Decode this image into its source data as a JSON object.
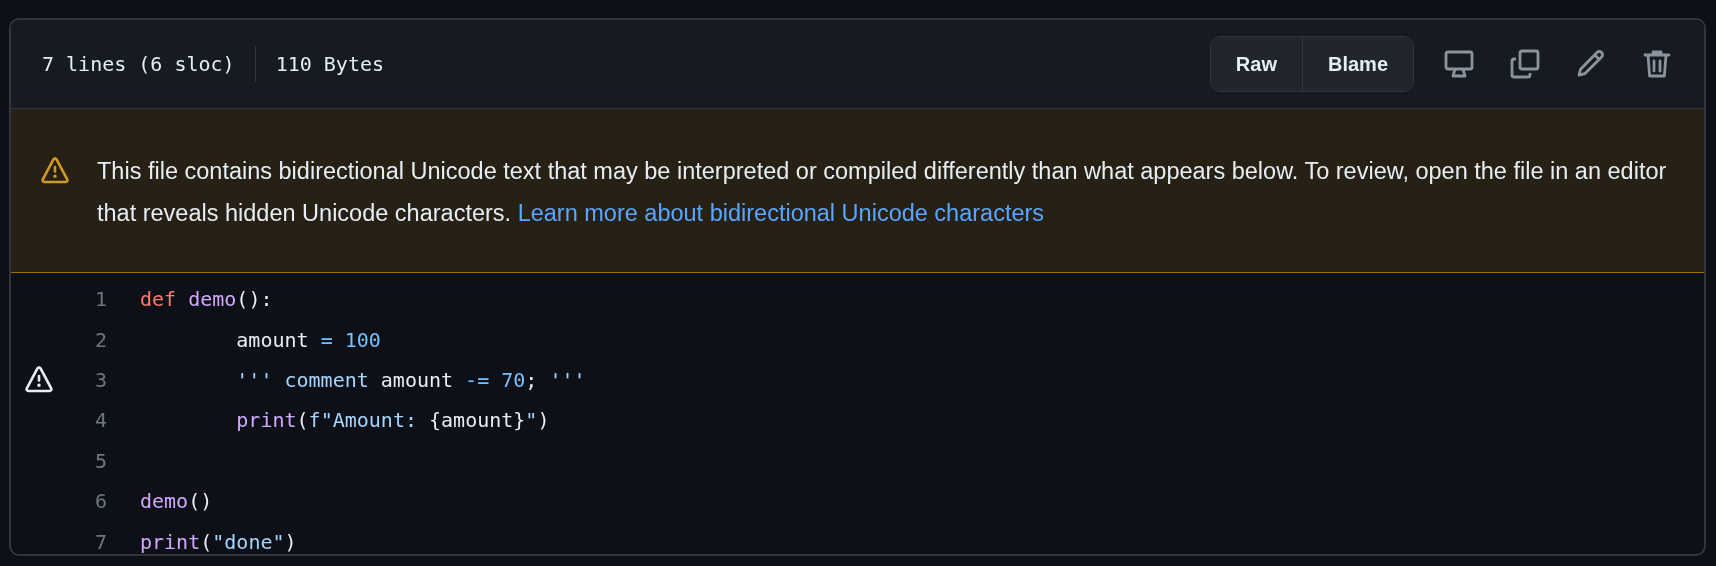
{
  "file_info": {
    "lines": "7 lines (6 sloc)",
    "size": "110 Bytes"
  },
  "buttons": [
    "Raw",
    "Blame"
  ],
  "warning": {
    "text": "This file contains bidirectional Unicode text that may be interpreted or compiled differently than what appears below. To review, open the file in an editor that reveals hidden Unicode characters.",
    "link": "Learn more about bidirectional Unicode characters"
  },
  "code_lines": [
    {
      "number": "1",
      "warning": false,
      "tokens": [
        {
          "kind": "keyword",
          "text": "def "
        },
        {
          "kind": "function",
          "text": "demo"
        },
        {
          "kind": "plain",
          "text": "():"
        }
      ]
    },
    {
      "number": "2",
      "warning": false,
      "tokens": [
        {
          "kind": "plain",
          "text": "        amount "
        },
        {
          "kind": "operator",
          "text": "="
        },
        {
          "kind": "number",
          "text": " 100"
        }
      ]
    },
    {
      "number": "3",
      "warning": true,
      "tokens": [
        {
          "kind": "string",
          "text": "        ''' comment"
        },
        {
          "kind": "plain",
          "text": " amount "
        },
        {
          "kind": "operator",
          "text": "-="
        },
        {
          "kind": "number",
          "text": " 70"
        },
        {
          "kind": "plain",
          "text": "; "
        },
        {
          "kind": "string",
          "text": "'''"
        }
      ]
    },
    {
      "number": "4",
      "warning": false,
      "tokens": [
        {
          "kind": "function",
          "text": "        print"
        },
        {
          "kind": "plain",
          "text": "("
        },
        {
          "kind": "string",
          "text": "f\"Amount: "
        },
        {
          "kind": "plain",
          "text": "{amount}"
        },
        {
          "kind": "string",
          "text": "\""
        },
        {
          "kind": "plain",
          "text": ")"
        }
      ]
    },
    {
      "number": "5",
      "warning": false
    },
    {
      "number": "6",
      "warning": false,
      "tokens": [
        {
          "kind": "function",
          "text": "demo"
        },
        {
          "kind": "plain",
          "text": "()"
        }
      ]
    },
    {
      "number": "7",
      "warning": false,
      "tokens": [
        {
          "kind": "function",
          "text": "print"
        },
        {
          "kind": "plain",
          "text": "("
        },
        {
          "kind": "string",
          "text": "\"done\""
        },
        {
          "kind": "plain",
          "text": ")"
        }
      ]
    }
  ]
}
